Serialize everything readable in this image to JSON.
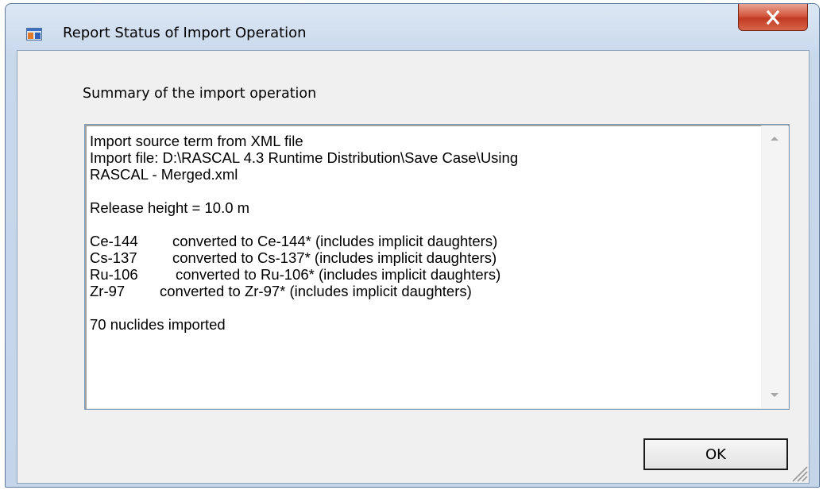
{
  "window": {
    "title": "Report Status of Import Operation",
    "app_icon": "window-app-icon",
    "close_icon": "close-icon"
  },
  "summary_label": "Summary of the import operation",
  "report": {
    "line1": "Import source term from XML file",
    "line2": "Import file: D:\\RASCAL 4.3 Runtime Distribution\\Save Case\\Using",
    "line3": "RASCAL - Merged.xml",
    "release_height": "Release height = 10.0 m",
    "conversions": [
      {
        "nuclide": "Ce-144",
        "text": "converted to Ce-144* (includes implicit daughters)"
      },
      {
        "nuclide": "Cs-137",
        "text": "converted to Cs-137* (includes implicit daughters)"
      },
      {
        "nuclide": "Ru-106",
        "text": "converted to Ru-106* (includes implicit daughters)"
      },
      {
        "nuclide": "Zr-97",
        "text": "converted to Zr-97* (includes implicit daughters)"
      }
    ],
    "count": "70 nuclides imported"
  },
  "ok_label": "OK",
  "scrollbar": {
    "up_icon": "scroll-up-arrow-icon",
    "down_icon": "scroll-down-arrow-icon"
  },
  "colors": {
    "close_button": "#c94a2e",
    "frame": "#c9d9ec",
    "client": "#f0f0f0"
  }
}
